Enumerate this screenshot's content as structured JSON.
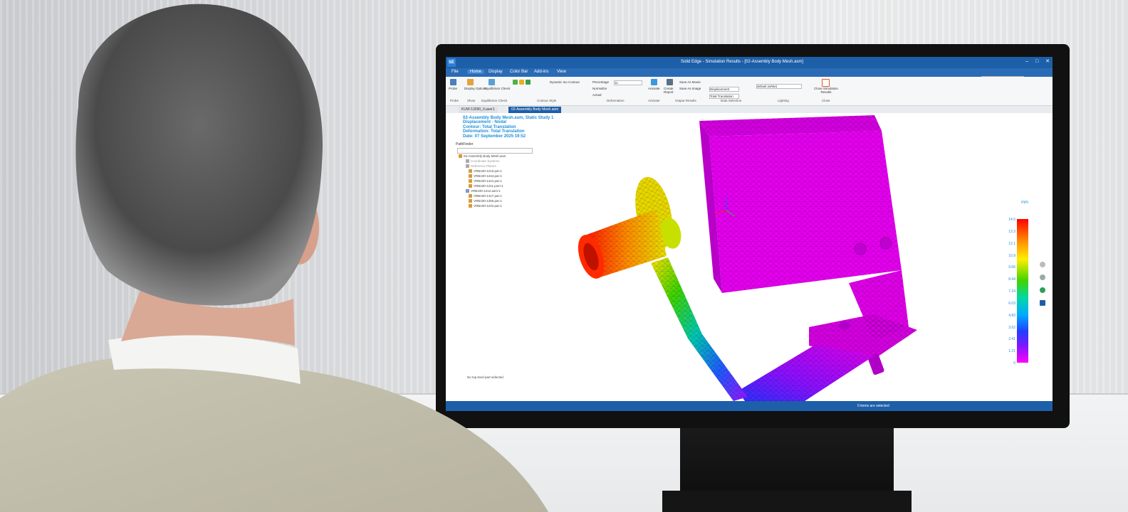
{
  "app": {
    "title": "Solid Edge - Simulation Results - [02-Assembly Body Mesh.asm]",
    "logo": "SE"
  },
  "menu": {
    "items": [
      "File",
      "Home",
      "Display",
      "Color Bar",
      "Add-ins",
      "View"
    ],
    "active": "Home"
  },
  "search": {
    "placeholder": "Type to find tools"
  },
  "ribbon": {
    "buttons": {
      "probe": "Probe",
      "display_options": "Display Options",
      "equilibrium_check": "Equilibrium Check",
      "dynamic_iso_contour": "Dynamic Iso Contour",
      "percentage": "Percentage",
      "percentage_value": "11",
      "normalize": "Normalize",
      "actual": "Actual",
      "animate": "Animate",
      "create_report": "Create Report",
      "save_as_movie": "Save As Movie",
      "save_as_image": "Save As Image",
      "displacement": "Displacement",
      "total_translation": "Total Translation",
      "default_lighting": "default (white)",
      "close_results": "Close Simulation Results"
    },
    "groups": [
      "Probe",
      "Show",
      "Equilibrium Check",
      "Contour Style",
      "Deformation",
      "Animate",
      "Output Results",
      "Data Selection",
      "Lighting",
      "Close"
    ]
  },
  "doc_tabs": [
    {
      "label": "KUW-13090_/Laser1",
      "active": false
    },
    {
      "label": "02-Assembly Body Mesh.asm",
      "active": true
    }
  ],
  "study_info": [
    "02-Assembly Body Mesh.asm, Static Study 1",
    "Displacement - Nodal",
    "Contour: Total Translation",
    "Deformation: Total Translation",
    "Date: 07 September 2025  19:52"
  ],
  "pathfinder": {
    "title": "PathFinder",
    "items": [
      "02-Assembly Body Mesh.asm",
      "Coordinate Systems",
      "Reference Planes",
      "VRB100-1210.par:1",
      "VRB100-1244.par:1",
      "VRB100-1441.par:1",
      "VRB100-1211.psm:1",
      "VRB100-1212.asm:1",
      "VRB100-1417.par:1",
      "VRB100-1255.par:1",
      "VRB100-1222.par:1"
    ]
  },
  "status_left": "No top level part selected",
  "status_bar": "0 items are selected",
  "legend": {
    "units": "mm",
    "labels": [
      "14.5",
      "13.3",
      "12.1",
      "10.9",
      "9.66",
      "8.44",
      "7.24",
      "6.03",
      "4.83",
      "3.62",
      "2.41",
      "1.21",
      "0"
    ]
  },
  "colors": {
    "accent": "#1d5fa8",
    "info_text": "#1f8fd6",
    "mesh_magenta": "#e000e8"
  }
}
